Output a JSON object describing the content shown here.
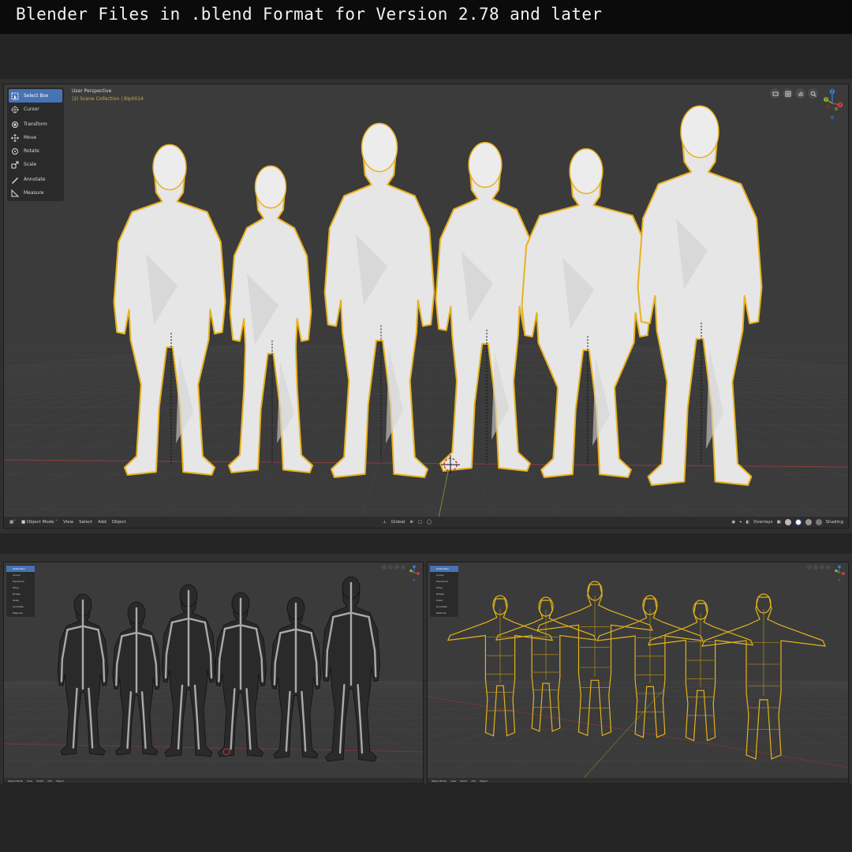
{
  "banner": {
    "title": "Blender Files in .blend Format for Version 2.78 and later"
  },
  "main_viewport": {
    "perspective_label": "User Perspective",
    "collection_label": "(2) Scene Collection | Bip0014",
    "tools": [
      {
        "label": "Select Box",
        "icon": "select-box-icon",
        "active": true
      },
      {
        "label": "Cursor",
        "icon": "cursor-icon",
        "active": false
      },
      {
        "label": "Transform",
        "icon": "transform-icon",
        "active": false
      },
      {
        "label": "Move",
        "icon": "move-icon",
        "active": false
      },
      {
        "label": "Rotate",
        "icon": "rotate-icon",
        "active": false
      },
      {
        "label": "Scale",
        "icon": "scale-icon",
        "active": false
      },
      {
        "label": "Annotate",
        "icon": "annotate-icon",
        "active": false
      },
      {
        "label": "Measure",
        "icon": "measure-icon",
        "active": false
      }
    ],
    "header": {
      "mode": "Object Mode",
      "menus": [
        "View",
        "Select",
        "Add",
        "Object"
      ],
      "transform_orientation": "Global",
      "overlays": "Overlays",
      "shading": "Shading"
    },
    "nav_icons": [
      "camera-view-icon",
      "grid-icon",
      "hand-pan-icon",
      "zoom-icon"
    ],
    "gizmo_axes": [
      "Z",
      "Y",
      "X"
    ],
    "colors": {
      "selection_outline": "#e8b21e",
      "active_tool": "#4772b3",
      "axis_x": "#d9404a",
      "axis_y": "#86b72a",
      "axis_z": "#3f80d8"
    }
  },
  "wire_viewport": {
    "tools": [
      "Select Box",
      "Cursor",
      "Transform",
      "Move",
      "Rotate",
      "Scale",
      "Annotate",
      "Measure"
    ],
    "header": {
      "mode": "Object Mode",
      "menus": [
        "View",
        "Select",
        "Add",
        "Object"
      ]
    }
  },
  "yellow_viewport": {
    "tools": [
      "Select Box",
      "Cursor",
      "Transform",
      "Move",
      "Rotate",
      "Scale",
      "Annotate",
      "Measure"
    ],
    "header": {
      "mode": "Object Mode",
      "menus": [
        "View",
        "Select",
        "Add",
        "Object"
      ]
    }
  }
}
